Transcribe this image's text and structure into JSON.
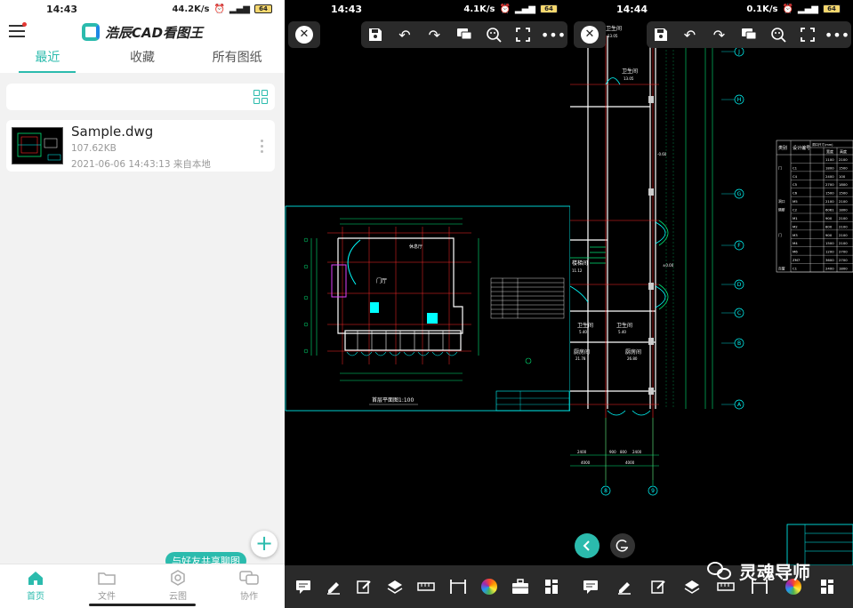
{
  "colors": {
    "accent": "#2bbbad",
    "cad_cyan": "#00ffff",
    "cad_red": "#ff2a2a",
    "cad_green": "#00e676",
    "toolbar_bg": "#2a2a2a"
  },
  "screen1": {
    "status": {
      "time": "14:43",
      "net": "44.2K/s",
      "battery": "64"
    },
    "app_title": "浩辰CAD看图王",
    "tabs": [
      "最近",
      "收藏",
      "所有图纸"
    ],
    "file": {
      "name": "Sample.dwg",
      "size": "107.62KB",
      "date": "2021-06-06 14:43:13 来自本地"
    },
    "share_tip": "与好友共享聊图",
    "nav": [
      "首页",
      "文件",
      "云图",
      "协作"
    ]
  },
  "screen2": {
    "status": {
      "time": "14:43",
      "net": "4.1K/s",
      "battery": "64"
    },
    "drawing_caption": "首层平面图1:100",
    "labels": {
      "hall": "门厅",
      "room": "休息厅"
    }
  },
  "screen3": {
    "status": {
      "time": "14:44",
      "net": "0.1K/s",
      "battery": "64"
    },
    "rooms": [
      {
        "name": "卫生间",
        "area": "13.05"
      },
      {
        "name": "卫生间",
        "area": "13.05"
      },
      {
        "name": "卫生间",
        "area": "5.40"
      },
      {
        "name": "卫生间",
        "area": "5.40"
      },
      {
        "name": "厨房间",
        "area": "21.78"
      },
      {
        "name": "厨房间",
        "area": "26.80"
      },
      {
        "name": "楼梯间",
        "area": "11.12"
      }
    ],
    "grid_letters": [
      "J",
      "H",
      "G",
      "F",
      "D",
      "C",
      "B",
      "A"
    ],
    "grid_numbers": [
      "8",
      "9"
    ],
    "dims": [
      "2400",
      "900",
      "800",
      "2400",
      "4000",
      "4000"
    ],
    "levels": [
      "-0.60",
      "±0.00"
    ],
    "table_headers": [
      "类别",
      "设计编号",
      "洞口尺寸(mm)",
      "宽度",
      "高度"
    ],
    "table_rows": [
      [
        "",
        "",
        "",
        "1100",
        "2100"
      ],
      [
        "门",
        "C1",
        "",
        "1800",
        "1500"
      ],
      [
        "",
        "C4",
        "",
        "2400",
        "100"
      ],
      [
        "",
        "C5",
        "",
        "2700",
        "1800"
      ],
      [
        "",
        "C6",
        "",
        "1500",
        "1500"
      ],
      [
        "洞口",
        "M5",
        "",
        "2100",
        "2100"
      ],
      [
        "隔断",
        "C2",
        "",
        "6061",
        "1800"
      ],
      [
        "",
        "M1",
        "",
        "900",
        "2100"
      ],
      [
        "",
        "M2",
        "",
        "800",
        "2100"
      ],
      [
        "门",
        "M3",
        "",
        "900",
        "2100"
      ],
      [
        "",
        "M4",
        "",
        "1500",
        "2100"
      ],
      [
        "",
        "M6",
        "",
        "1200",
        "2700"
      ],
      [
        "",
        "ZM7",
        "",
        "3600",
        "2700"
      ],
      [
        "百窗",
        "C1",
        "",
        "2400",
        "1800"
      ]
    ],
    "watermark": "灵魂导师"
  }
}
